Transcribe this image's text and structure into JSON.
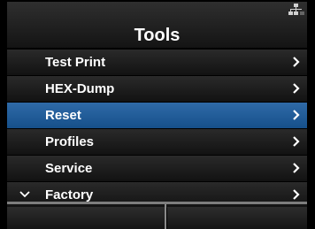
{
  "header": {
    "title": "Tools",
    "status_icon": "network-icon"
  },
  "menu": {
    "items": [
      {
        "label": "Test Print",
        "icon": "chevron-right-icon"
      },
      {
        "label": "HEX-Dump",
        "icon": "chevron-right-icon"
      },
      {
        "label": "Reset",
        "icon": "chevron-right-icon",
        "selected": true
      },
      {
        "label": "Profiles",
        "icon": "chevron-right-icon"
      },
      {
        "label": "Service",
        "icon": "chevron-right-icon"
      },
      {
        "label": "Factory",
        "icon": "chevron-right-icon",
        "expand_icon": "chevron-down-icon"
      }
    ]
  },
  "colors": {
    "selected_row": "#1f5c99",
    "row_background": "#1c1c1c",
    "text": "#ffffff"
  }
}
